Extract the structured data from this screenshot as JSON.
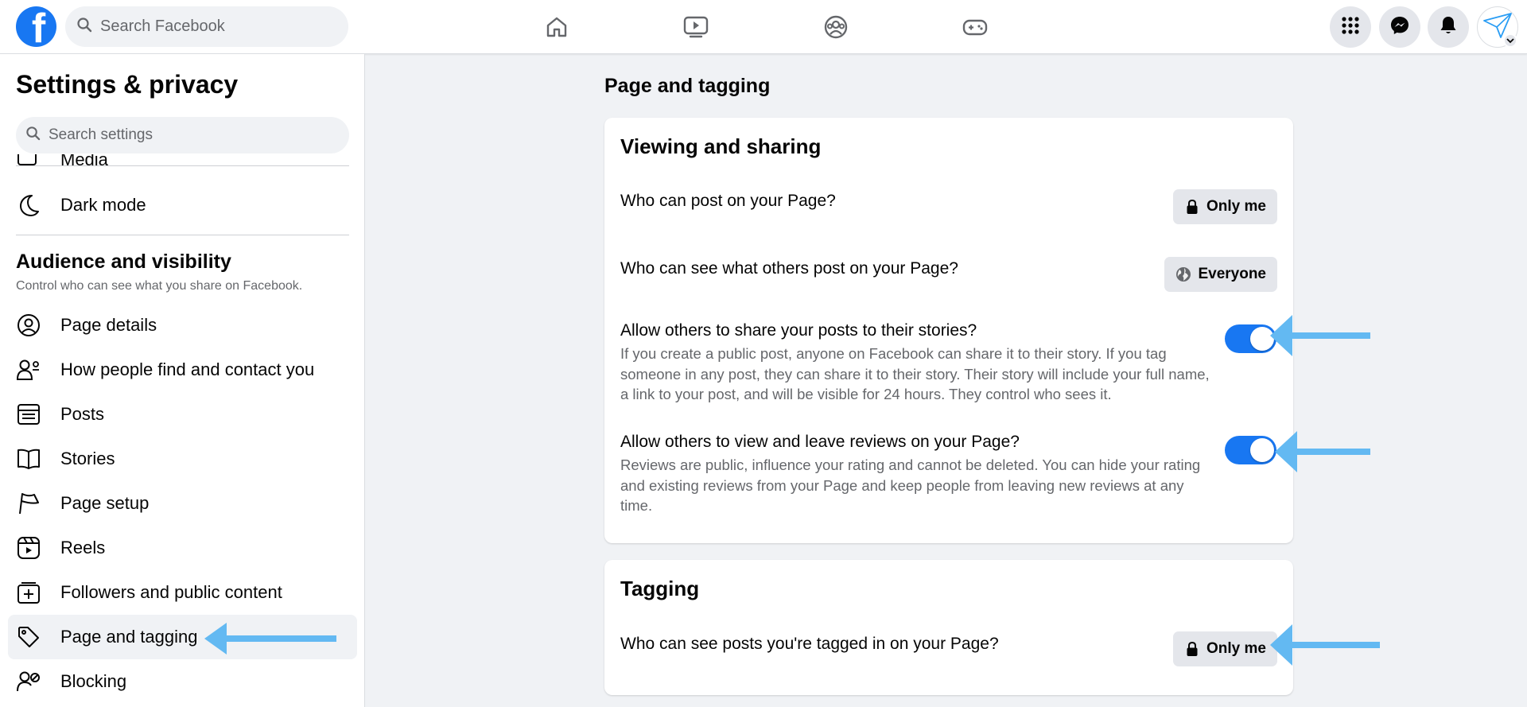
{
  "topbar": {
    "logo_letter": "f",
    "search_placeholder": "Search Facebook",
    "brand_color": "#1877f2"
  },
  "sidebar": {
    "title": "Settings & privacy",
    "search_placeholder": "Search settings",
    "cut_item": "Media",
    "dark_mode": "Dark mode",
    "section_title": "Audience and visibility",
    "section_subtitle": "Control who can see what you share on Facebook.",
    "items": [
      {
        "label": "Page details",
        "icon": "profile-circle-icon"
      },
      {
        "label": "How people find and contact you",
        "icon": "people-find-icon"
      },
      {
        "label": "Posts",
        "icon": "posts-icon"
      },
      {
        "label": "Stories",
        "icon": "book-icon"
      },
      {
        "label": "Page setup",
        "icon": "flag-icon"
      },
      {
        "label": "Reels",
        "icon": "reels-icon"
      },
      {
        "label": "Followers and public content",
        "icon": "followers-icon"
      },
      {
        "label": "Page and tagging",
        "icon": "tag-icon",
        "active": true
      },
      {
        "label": "Blocking",
        "icon": "blocking-icon"
      }
    ]
  },
  "main": {
    "title": "Page and tagging",
    "viewing": {
      "title": "Viewing and sharing",
      "rows": [
        {
          "label": "Who can post on your Page?",
          "value": "Only me",
          "icon": "lock-icon"
        },
        {
          "label": "Who can see what others post on your Page?",
          "value": "Everyone",
          "icon": "globe-icon"
        }
      ],
      "toggles": [
        {
          "label": "Allow others to share your posts to their stories?",
          "description": "If you create a public post, anyone on Facebook can share it to their story. If you tag someone in any post, they can share it to their story. Their story will include your full name, a link to your post, and will be visible for 24 hours. They control who sees it.",
          "on": true
        },
        {
          "label": "Allow others to view and leave reviews on your Page?",
          "description": "Reviews are public, influence your rating and cannot be deleted. You can hide your rating and existing reviews from your Page and keep people from leaving new reviews at any time.",
          "on": true
        }
      ]
    },
    "tagging": {
      "title": "Tagging",
      "rows": [
        {
          "label": "Who can see posts you're tagged in on your Page?",
          "value": "Only me",
          "icon": "lock-icon"
        }
      ]
    }
  },
  "annotation_color": "#63b9f2"
}
